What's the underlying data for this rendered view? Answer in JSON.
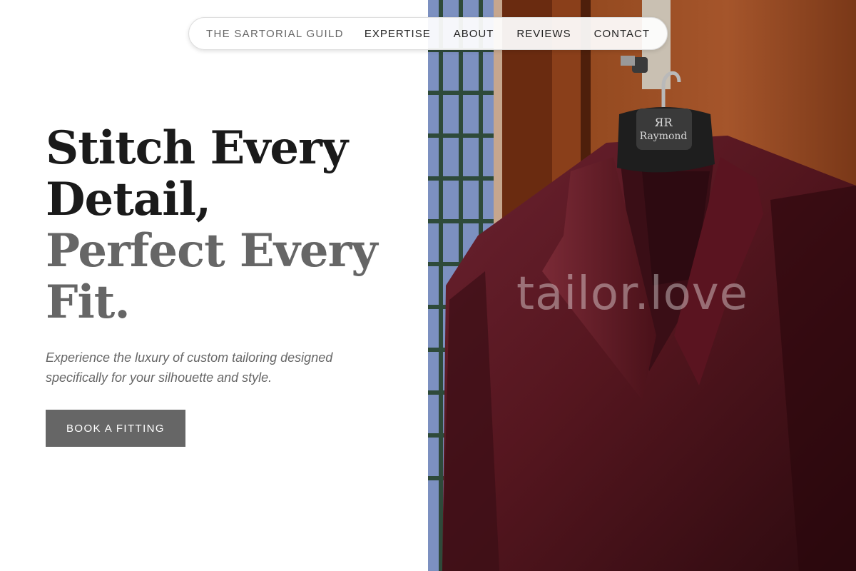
{
  "nav": {
    "brand": "THE SARTORIAL GUILD",
    "links": [
      "EXPERTISE",
      "ABOUT",
      "REVIEWS",
      "CONTACT"
    ]
  },
  "hero": {
    "headline_lines": [
      "Stitch Every",
      "Detail,",
      "Perfect Every",
      "Fit."
    ],
    "subtext": "Experience the luxury of custom tailoring designed specifically for your silhouette and style.",
    "cta_label": "BOOK A FITTING",
    "image": {
      "alt": "Maroon suit jacket hanging on a wooden door",
      "hanger_logo": "Raymond",
      "watermark": "tailor.love"
    }
  },
  "colors": {
    "headline_dark": "#1a1a1a",
    "headline_muted": "#666666",
    "cta_background": "#666666",
    "suit": "#5a1a22",
    "door": "#8b4522"
  }
}
